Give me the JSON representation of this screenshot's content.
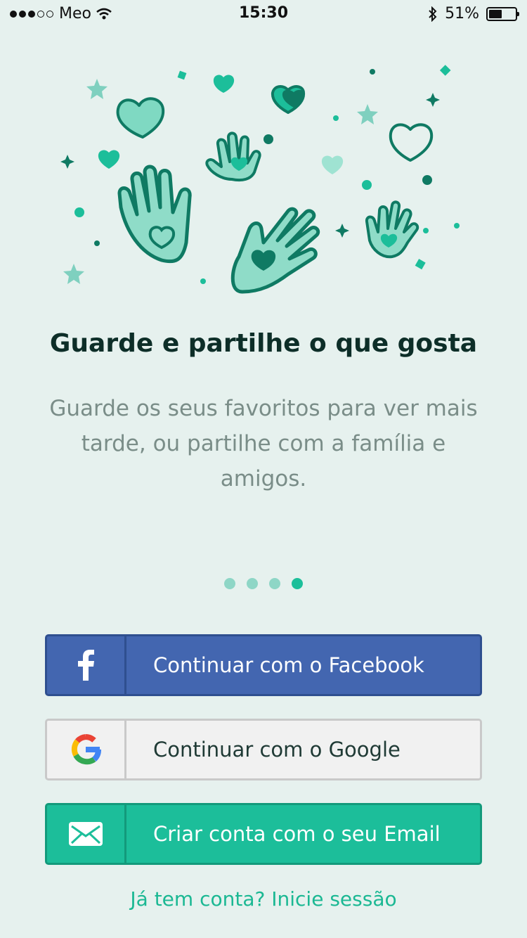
{
  "status_bar": {
    "carrier": "Meo",
    "time": "15:30",
    "battery": "51%",
    "battery_level": 0.51,
    "icons": [
      "signal-dots",
      "wifi-icon",
      "bluetooth-icon",
      "battery-icon"
    ]
  },
  "onboarding": {
    "title": "Guarde e partilhe o que gosta",
    "description": "Guarde os seus favoritos para ver mais tarde, ou partilhe com a família e amigos.",
    "pager": {
      "total": 4,
      "active_index": 3
    }
  },
  "buttons": {
    "facebook_label": "Continuar com o Facebook",
    "google_label": "Continuar com o Google",
    "email_label": "Criar conta com o seu Email"
  },
  "signin_link": "Já tem conta? Inicie sessão",
  "colors": {
    "background": "#e6f1ee",
    "facebook": "#4366b0",
    "email": "#1cbe9a",
    "accent": "#1bb893"
  }
}
